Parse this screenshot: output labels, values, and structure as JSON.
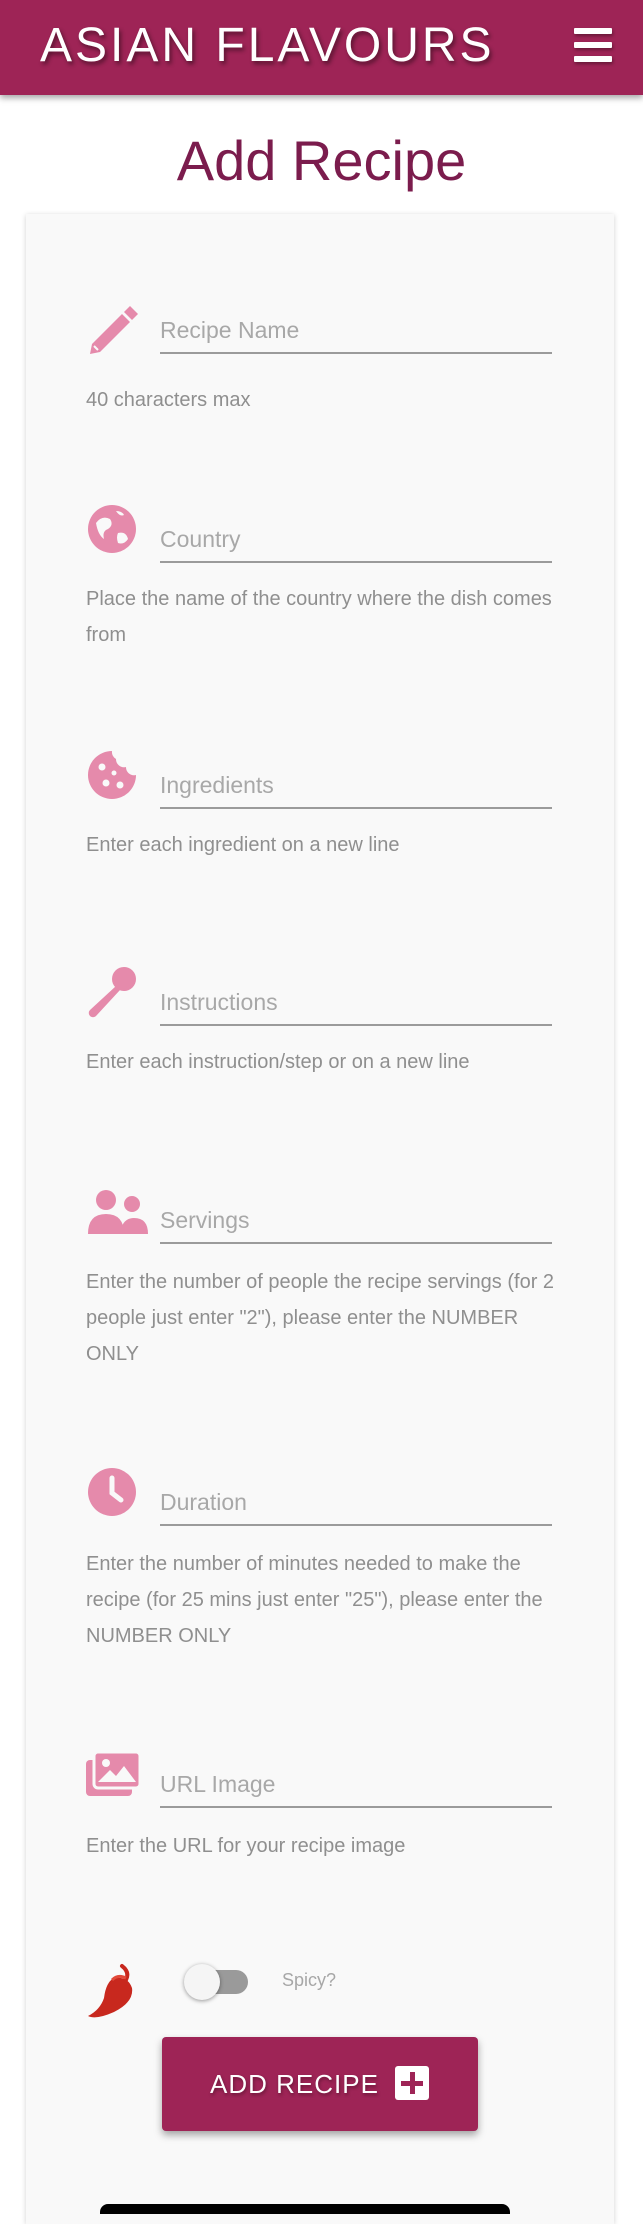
{
  "navbar": {
    "brand": "ASIAN FLAVOURS",
    "menu_icon": "hamburger-menu-icon",
    "background": "#9e2456"
  },
  "page": {
    "title": "Add Recipe"
  },
  "form": {
    "recipe_name": {
      "placeholder": "Recipe Name",
      "value": "",
      "icon": "pencil-icon",
      "help": "40 characters max"
    },
    "country": {
      "placeholder": "Country",
      "value": "",
      "icon": "globe-icon",
      "help": "Place the name of the country where the dish comes from"
    },
    "ingredients": {
      "placeholder": "Ingredients",
      "value": "",
      "icon": "cookie-icon",
      "help": "Enter each ingredient on a new line"
    },
    "instructions": {
      "placeholder": "Instructions",
      "value": "",
      "icon": "spoon-icon",
      "help": "Enter each instruction/step or on a new line"
    },
    "servings": {
      "placeholder": "Servings",
      "value": "",
      "icon": "users-icon",
      "help": "Enter the number of people the recipe servings (for 2 people just enter \"2\"), please enter the NUMBER ONLY"
    },
    "duration": {
      "placeholder": "Duration",
      "value": "",
      "icon": "clock-icon",
      "help": "Enter the number of minutes needed to make the recipe (for 25 mins just enter \"25\"), please enter the NUMBER ONLY"
    },
    "url_image": {
      "placeholder": "URL Image",
      "value": "",
      "icon": "images-icon",
      "help": "Enter the URL for your recipe image"
    },
    "spicy": {
      "label": "Spicy?",
      "checked": false,
      "icon": "chili-pepper-icon"
    },
    "submit": {
      "label": "ADD RECIPE",
      "icon": "plus-square-icon"
    }
  },
  "colors": {
    "accent": "#9e2456",
    "icon": "#e58aab",
    "title": "#7b1c4d",
    "chili": "#c8281e"
  }
}
